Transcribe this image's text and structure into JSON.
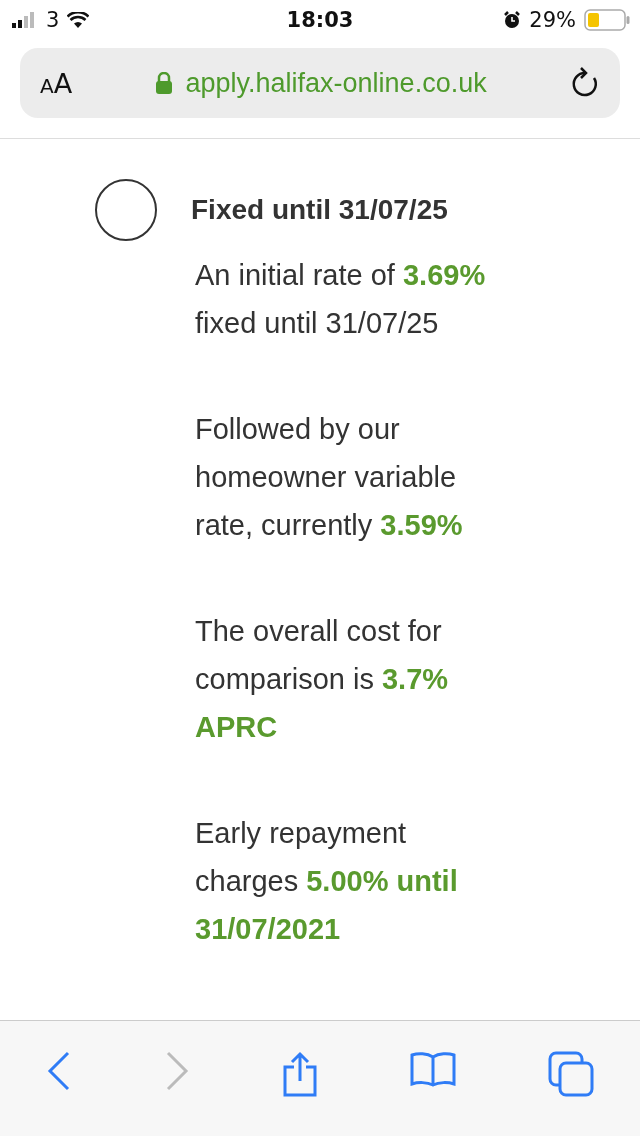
{
  "status_bar": {
    "carrier": "3",
    "time": "18:03",
    "battery": "29%"
  },
  "address_bar": {
    "text_size": [
      "A",
      "A"
    ],
    "url": "apply.halifax-online.co.uk"
  },
  "option": {
    "title": "Fixed until 31/07/25",
    "selected": false,
    "paragraphs": [
      "An initial rate of **3.69%** fixed until 31/07/25",
      "Followed by our homeowner variable rate, currently **3.59%**",
      "The overall cost for comparison is **3.7% APRC**",
      "Early repayment charges **5.00% until 31/07/2021**"
    ]
  },
  "toolbar": [
    {
      "kind": "back",
      "disabled": false
    },
    {
      "kind": "forward",
      "disabled": true
    },
    {
      "kind": "share",
      "disabled": false
    },
    {
      "kind": "bookmarks",
      "disabled": false
    },
    {
      "kind": "tabs",
      "disabled": false
    }
  ]
}
